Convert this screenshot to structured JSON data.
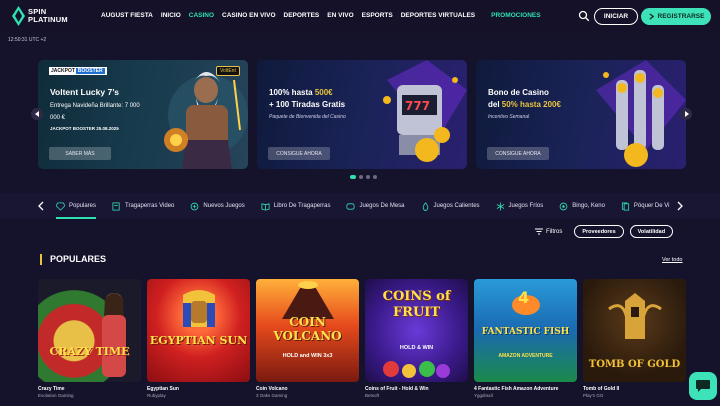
{
  "header": {
    "logo_line1": "SPIN",
    "logo_line2": "PLATINUM",
    "nav": [
      "AUGUST FIESTA",
      "INICIO",
      "CASINO",
      "CASINO EN VIVO",
      "DEPORTES",
      "EN VIVO",
      "ESPORTS",
      "DEPORTES VIRTUALES"
    ],
    "nav_active_index": 2,
    "promo": "PROMOCIONES",
    "login": "INICIAR",
    "register": "REGISTRARSE"
  },
  "clock": "12:50:31 UTC +2",
  "banners": [
    {
      "tag_left": "JACKPOT",
      "tag_right": "BOOSTER",
      "provider": "VoltEnt",
      "title": "Voltent Lucky 7’s",
      "subtitle": "Entrega Navideña Brillante: 7 000 000 €",
      "date": "JACKPOT BOOSTER 25.08.2025",
      "button": "SABER MÁS"
    },
    {
      "title_a": "100% hasta ",
      "title_hl": "500€",
      "title_b": "+ 100 Tiradas Gratis",
      "subtitle": "Paquete de Bienvenida del Casino",
      "button": "CONSIGUE AHORA"
    },
    {
      "title_a": "Bono de Casino",
      "title_b": "del ",
      "title_hl": "50% hasta 200€",
      "subtitle": "Incentivo Semanal",
      "button": "CONSIGUE AHORA"
    }
  ],
  "categories": [
    "Populares",
    "Tragaperras Video",
    "Nuevos Juegos",
    "Libro De Tragaperras",
    "Juegos De Mesa",
    "Juegos Calientes",
    "Juegos Fríos",
    "Bingo, Keno",
    "Póquer De Vi"
  ],
  "filters": {
    "label": "Filtros",
    "providers": "Proveedores",
    "volatility": "Volatilidad"
  },
  "section": {
    "title": "POPULARES",
    "see_all": "Ver todo"
  },
  "games": [
    {
      "name": "Crazy Time",
      "provider": "Evolution Gaming",
      "art": "CRAZY TIME"
    },
    {
      "name": "Egyptian Sun",
      "provider": "Rubyplay",
      "art": "EGYPTIAN SUN"
    },
    {
      "name": "Coin Volcano",
      "provider": "3 Oaks Gaming",
      "art": "COIN VOLCANO",
      "art_sub": "HOLD and WIN 3x3"
    },
    {
      "name": "Coins of Fruit - Hold & Win",
      "provider": "Betsoft",
      "art": "COINS of FRUIT",
      "art_sub": "HOLD & WIN"
    },
    {
      "name": "4 Fantastic Fish Amazon Adventure",
      "provider": "Yggdrasil",
      "art": "FANTASTIC FISH",
      "art_sub": "AMAZON ADVENTURE"
    },
    {
      "name": "Tomb of Gold II",
      "provider": "Play'n GO",
      "art": "TOMB OF GOLD"
    }
  ],
  "colors": {
    "accent": "#2fe0b0",
    "highlight": "#e9c440",
    "background": "#15122b"
  }
}
